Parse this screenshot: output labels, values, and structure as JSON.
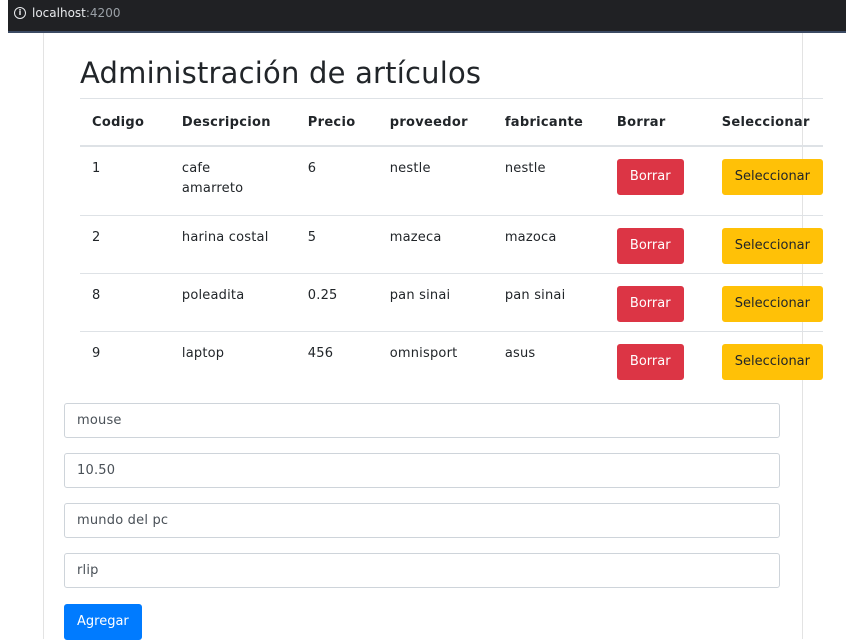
{
  "browser": {
    "url_host": "localhost",
    "url_port": ":4200"
  },
  "page": {
    "title": "Administración de artículos"
  },
  "table": {
    "headers": [
      "Codigo",
      "Descripcion",
      "Precio",
      "proveedor",
      "fabricante",
      "Borrar",
      "Seleccionar"
    ],
    "rows": [
      {
        "codigo": "1",
        "descripcion": "cafe amarreto",
        "precio": "6",
        "proveedor": "nestle",
        "fabricante": "nestle",
        "borrar_label": "Borrar",
        "seleccionar_label": "Seleccionar"
      },
      {
        "codigo": "2",
        "descripcion": "harina costal",
        "precio": "5",
        "proveedor": "mazeca",
        "fabricante": "mazoca",
        "borrar_label": "Borrar",
        "seleccionar_label": "Seleccionar"
      },
      {
        "codigo": "8",
        "descripcion": "poleadita",
        "precio": "0.25",
        "proveedor": "pan sinai",
        "fabricante": "pan sinai",
        "borrar_label": "Borrar",
        "seleccionar_label": "Seleccionar"
      },
      {
        "codigo": "9",
        "descripcion": "laptop",
        "precio": "456",
        "proveedor": "omnisport",
        "fabricante": "asus",
        "borrar_label": "Borrar",
        "seleccionar_label": "Seleccionar"
      }
    ]
  },
  "form": {
    "descripcion_value": "mouse",
    "precio_value": "10.50",
    "proveedor_value": "mundo del pc",
    "fabricante_value": "rlip",
    "add_label": "Agregar"
  },
  "colors": {
    "danger": "#dc3545",
    "warning": "#ffc107",
    "primary": "#007bff"
  }
}
